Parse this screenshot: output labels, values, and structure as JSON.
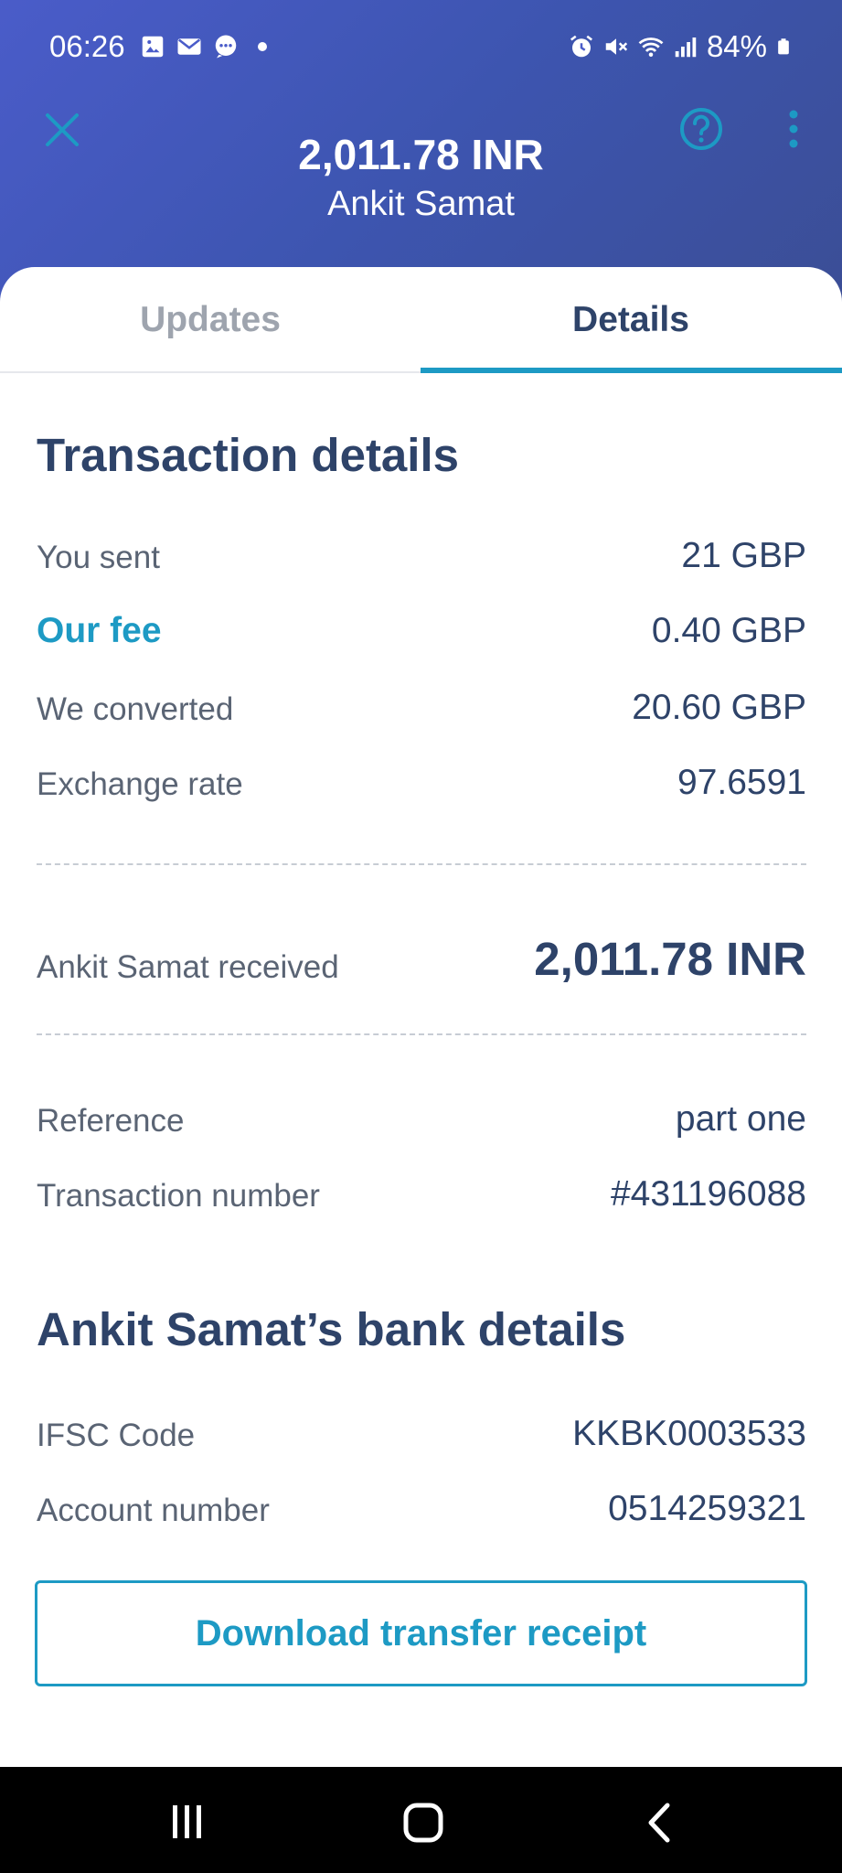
{
  "status_bar": {
    "time": "06:26",
    "battery": "84%",
    "left_icons": [
      "image-icon",
      "mail-icon",
      "chat-icon",
      "dot-icon"
    ],
    "right_icons": [
      "alarm-icon",
      "mute-icon",
      "wifi-icon",
      "signal-icon",
      "battery-icon"
    ]
  },
  "header": {
    "amount": "2,011.78 INR",
    "recipient": "Ankit Samat"
  },
  "tabs": [
    {
      "label": "Updates",
      "active": false
    },
    {
      "label": "Details",
      "active": true
    }
  ],
  "transaction": {
    "title": "Transaction details",
    "rows": [
      {
        "label": "You sent",
        "value": "21 GBP"
      },
      {
        "label": "Our fee",
        "value": "0.40 GBP"
      },
      {
        "label": "We converted",
        "value": "20.60 GBP"
      },
      {
        "label": "Exchange rate",
        "value": "97.6591"
      }
    ],
    "received": {
      "label": "Ankit Samat received",
      "value": "2,011.78 INR"
    },
    "reference": {
      "label": "Reference",
      "value": "part one"
    },
    "number": {
      "label": "Transaction number",
      "value": "#431196088"
    }
  },
  "bank": {
    "title": "Ankit Samat’s bank details",
    "rows": [
      {
        "label": "IFSC Code",
        "value": "KKBK0003533"
      },
      {
        "label": "Account number",
        "value": "0514259321"
      }
    ]
  },
  "download_button": "Download transfer receipt",
  "colors": {
    "header_bg": "#4a5cc9",
    "accent": "#1d9ac4",
    "text_dark": "#2e4369",
    "text_muted": "#5a6474"
  }
}
